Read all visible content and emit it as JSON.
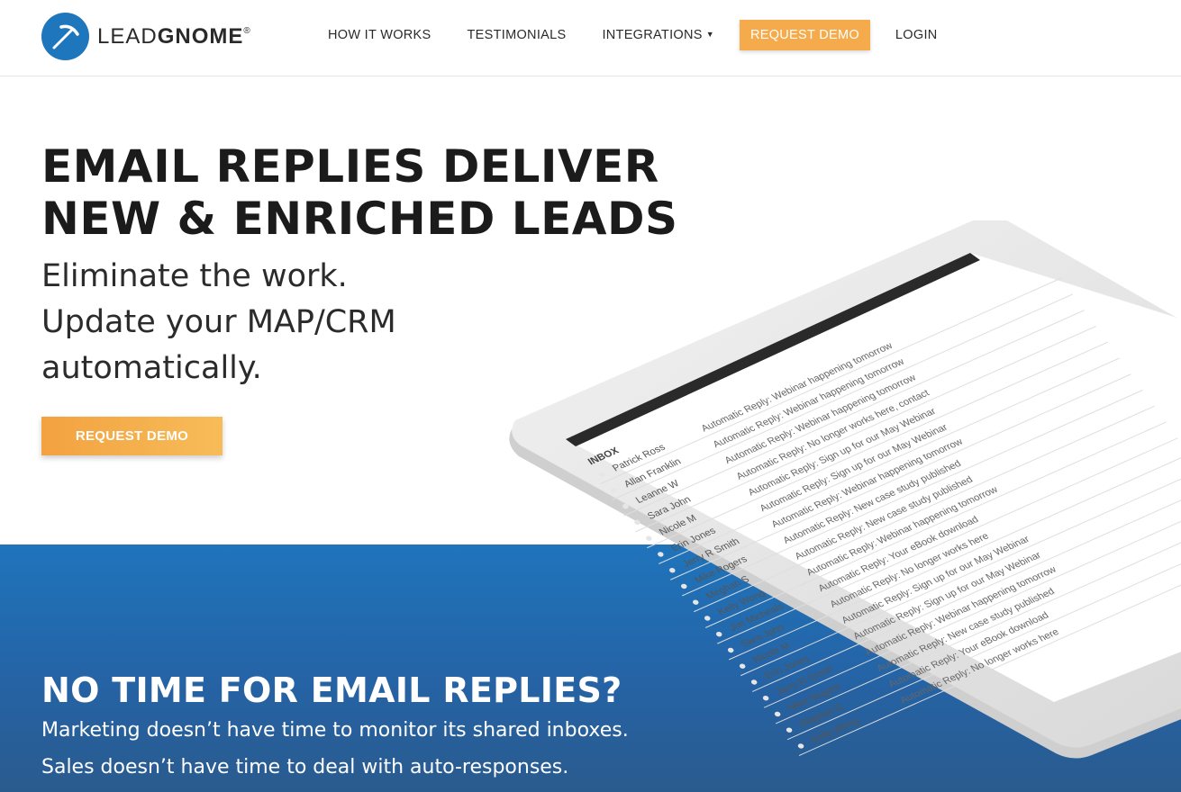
{
  "brand": {
    "name_light": "LEAD",
    "name_bold": "GNOME",
    "reg": "®"
  },
  "nav": {
    "items": [
      {
        "label": "HOW IT WORKS"
      },
      {
        "label": "TESTIMONIALS"
      },
      {
        "label": "INTEGRATIONS"
      }
    ],
    "cta_label": "REQUEST DEMO",
    "login_label": "LOGIN"
  },
  "hero": {
    "title_line1": "EMAIL REPLIES DELIVER",
    "title_line2": "NEW & ENRICHED LEADS",
    "sub_line1": "Eliminate the work.",
    "sub_line2": "Update your MAP/CRM",
    "sub_line3": "automatically.",
    "cta_label": "REQUEST DEMO"
  },
  "band": {
    "title": "NO TIME FOR EMAIL REPLIES?",
    "line1": "Marketing doesn’t have time to monitor its shared inboxes.",
    "line2": "Sales doesn’t have time to deal with auto-responses."
  },
  "inbox": {
    "header": "INBOX",
    "rows": [
      {
        "name": "Patrick Ross",
        "subject": "Automatic Reply: Webinar happening tomorrow"
      },
      {
        "name": "Allan Franklin",
        "subject": "Automatic Reply: Webinar happening tomorrow"
      },
      {
        "name": "Leanne W",
        "subject": "Automatic Reply: Webinar happening tomorrow"
      },
      {
        "name": "Sara John",
        "subject": "Automatic Reply: No longer works here, contact"
      },
      {
        "name": "Nicole M",
        "subject": "Automatic Reply: Sign up for our May Webinar"
      },
      {
        "name": "Erin Jones",
        "subject": "Automatic Reply: Sign up for our May Webinar"
      },
      {
        "name": "Jerry R Smith",
        "subject": "Automatic Reply: Webinar happening tomorrow"
      },
      {
        "name": "Mike Rogers",
        "subject": "Automatic Reply: New case study published"
      },
      {
        "name": "Meghan S",
        "subject": "Automatic Reply: New case study published"
      },
      {
        "name": "Kelly Wong",
        "subject": "Automatic Reply: Webinar happening tomorrow"
      },
      {
        "name": "Jim Micheals",
        "subject": "Automatic Reply: Your eBook download"
      },
      {
        "name": "Sara John",
        "subject": "Automatic Reply: No longer works here"
      },
      {
        "name": "Nicole M",
        "subject": "Automatic Reply: Sign up for our May Webinar"
      },
      {
        "name": "Erin Jones",
        "subject": "Automatic Reply: Sign up for our May Webinar"
      },
      {
        "name": "Jerry R Smith",
        "subject": "Automatic Reply: Webinar happening tomorrow"
      },
      {
        "name": "Mike Rogers",
        "subject": "Automatic Reply: New case study published"
      },
      {
        "name": "Meghan S",
        "subject": "Automatic Reply: Your eBook download"
      },
      {
        "name": "Kelly Wong",
        "subject": "Automatic Reply: No longer works here"
      }
    ]
  },
  "colors": {
    "brand_blue": "#1e76bd",
    "cta_orange": "#f5ab4c",
    "band_blue": "#2563a5"
  }
}
